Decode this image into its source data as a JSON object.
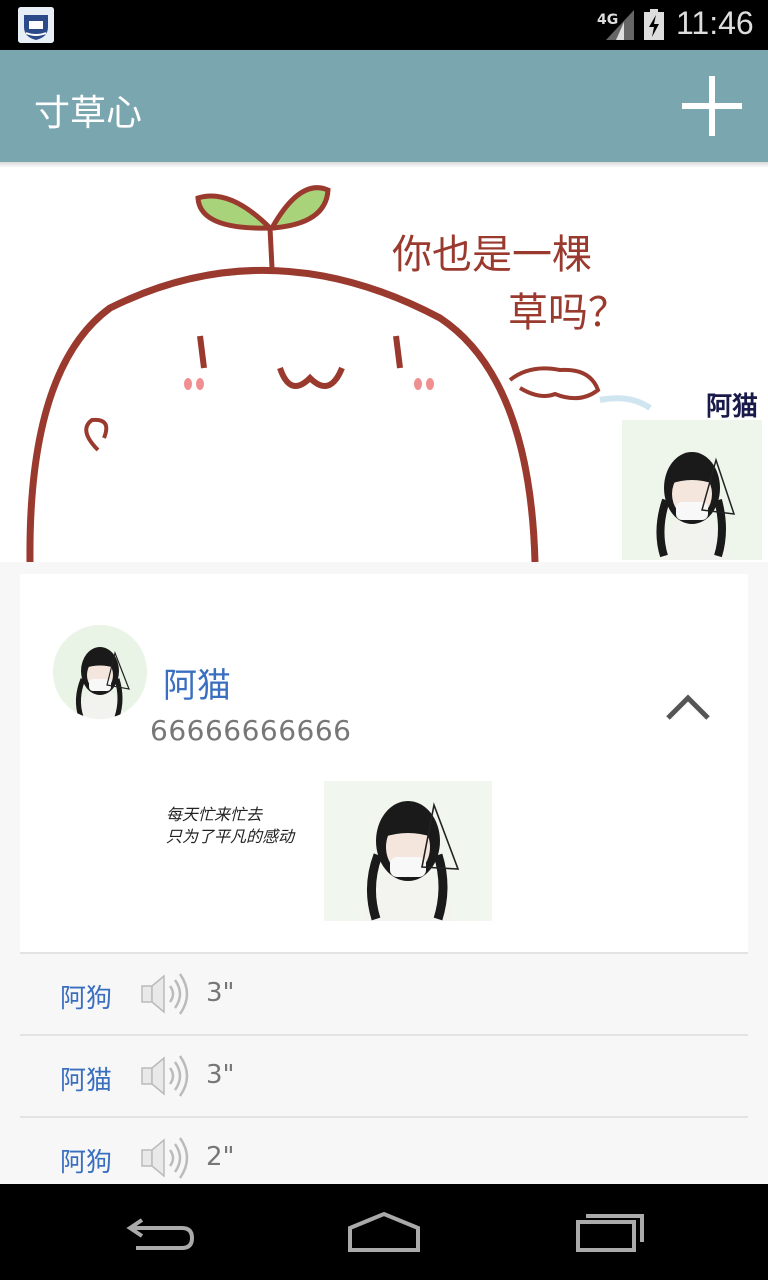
{
  "status_bar": {
    "network": "4G",
    "time": "11:46",
    "icons": [
      "app-logo-icon",
      "signal-icon",
      "battery-charging-icon"
    ]
  },
  "app_bar": {
    "title": "寸草心",
    "add_icon": "plus-icon"
  },
  "cover": {
    "speech_line1": "你也是一棵",
    "speech_line2": "草吗？",
    "user_name": "阿猫"
  },
  "post": {
    "author": "阿猫",
    "text": "66666666666",
    "collapse_icon": "chevron-up-icon",
    "image1_text_line1": "每天忙来忙去",
    "image1_text_line2": "只为了平凡的感动"
  },
  "voice_messages": [
    {
      "name": "阿狗",
      "duration": "3\""
    },
    {
      "name": "阿猫",
      "duration": "3\""
    },
    {
      "name": "阿狗",
      "duration": "2\""
    }
  ],
  "nav_bar": {
    "icons": [
      "back-icon",
      "home-icon",
      "recents-icon"
    ]
  },
  "colors": {
    "app_bar": "#7aa6b0",
    "name_blue": "#3a6fc0",
    "status_bar": "#000000"
  }
}
